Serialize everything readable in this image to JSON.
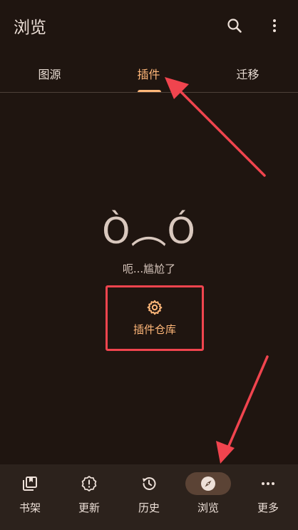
{
  "app": {
    "title": "浏览"
  },
  "tabs": [
    {
      "label": "图源",
      "selected": false
    },
    {
      "label": "插件",
      "selected": true
    },
    {
      "label": "迁移",
      "selected": false
    }
  ],
  "empty_state": {
    "kaomoji": "Ò︵Ó",
    "message": "呃...尴尬了",
    "action_label": "插件仓库"
  },
  "bottom_nav": [
    {
      "label": "书架",
      "icon": "library-icon",
      "active": false
    },
    {
      "label": "更新",
      "icon": "alert-badge-icon",
      "active": false
    },
    {
      "label": "历史",
      "icon": "history-icon",
      "active": false
    },
    {
      "label": "浏览",
      "icon": "compass-icon",
      "active": true
    },
    {
      "label": "更多",
      "icon": "more-horizontal-icon",
      "active": false
    }
  ],
  "colors": {
    "background": "#1f1510",
    "accent": "#ffb779",
    "annotation": "#f0444e",
    "nav_background": "#2c221c"
  }
}
